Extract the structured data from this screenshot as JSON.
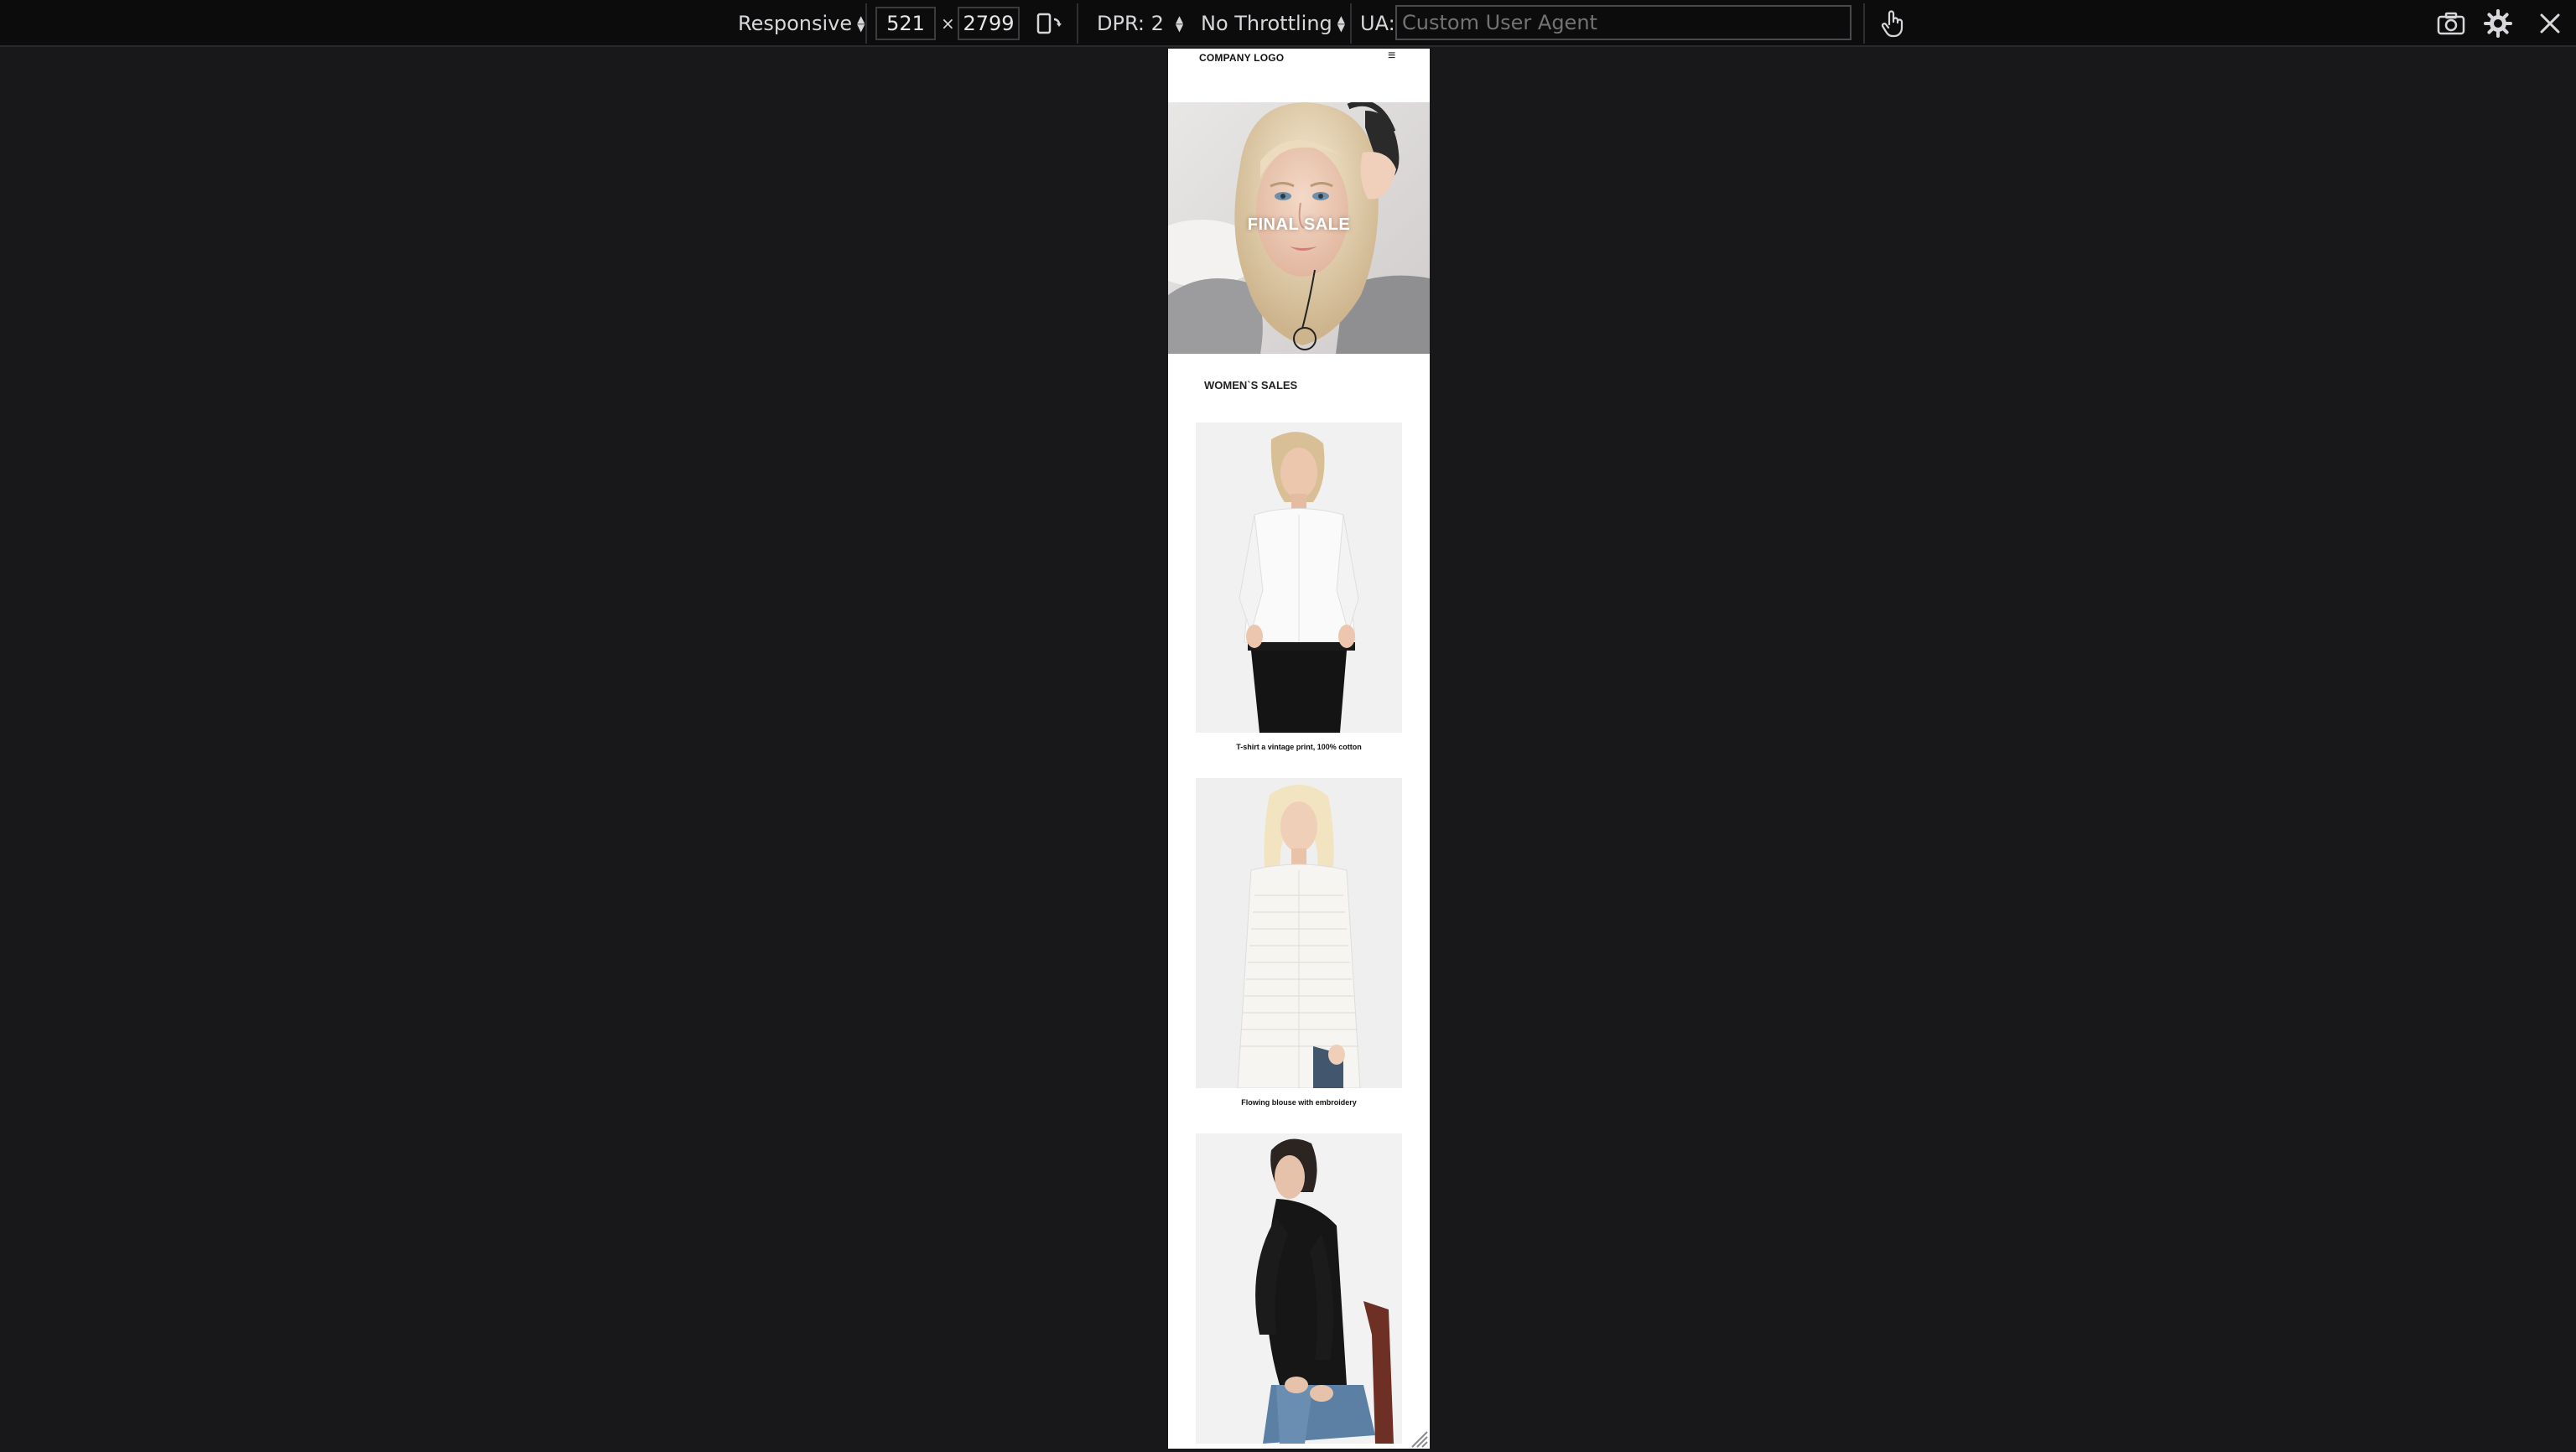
{
  "toolbar": {
    "device": "Responsive",
    "width": "521",
    "times": "×",
    "height": "2799",
    "dpr": "DPR: 2",
    "throttling": "No Throttling",
    "ua_label": "UA:",
    "ua_placeholder": "Custom User Agent",
    "icons": [
      "rotate-icon",
      "touch-icon",
      "screenshot-icon",
      "settings-icon",
      "close-icon"
    ]
  },
  "site": {
    "logo": "COMPANY LOGO",
    "menu_icon": "≡",
    "hero_title": "FINAL SALE",
    "section_title": "WOMEN`S SALES",
    "products": [
      {
        "caption": "T-shirt a vintage print, 100% cotton"
      },
      {
        "caption": "Flowing blouse with embroidery"
      },
      {
        "caption": ""
      }
    ]
  },
  "colors": {
    "toolbar_bg": "#0c0c0d",
    "page_bg": "#18181b",
    "viewport_bg": "#ffffff"
  }
}
